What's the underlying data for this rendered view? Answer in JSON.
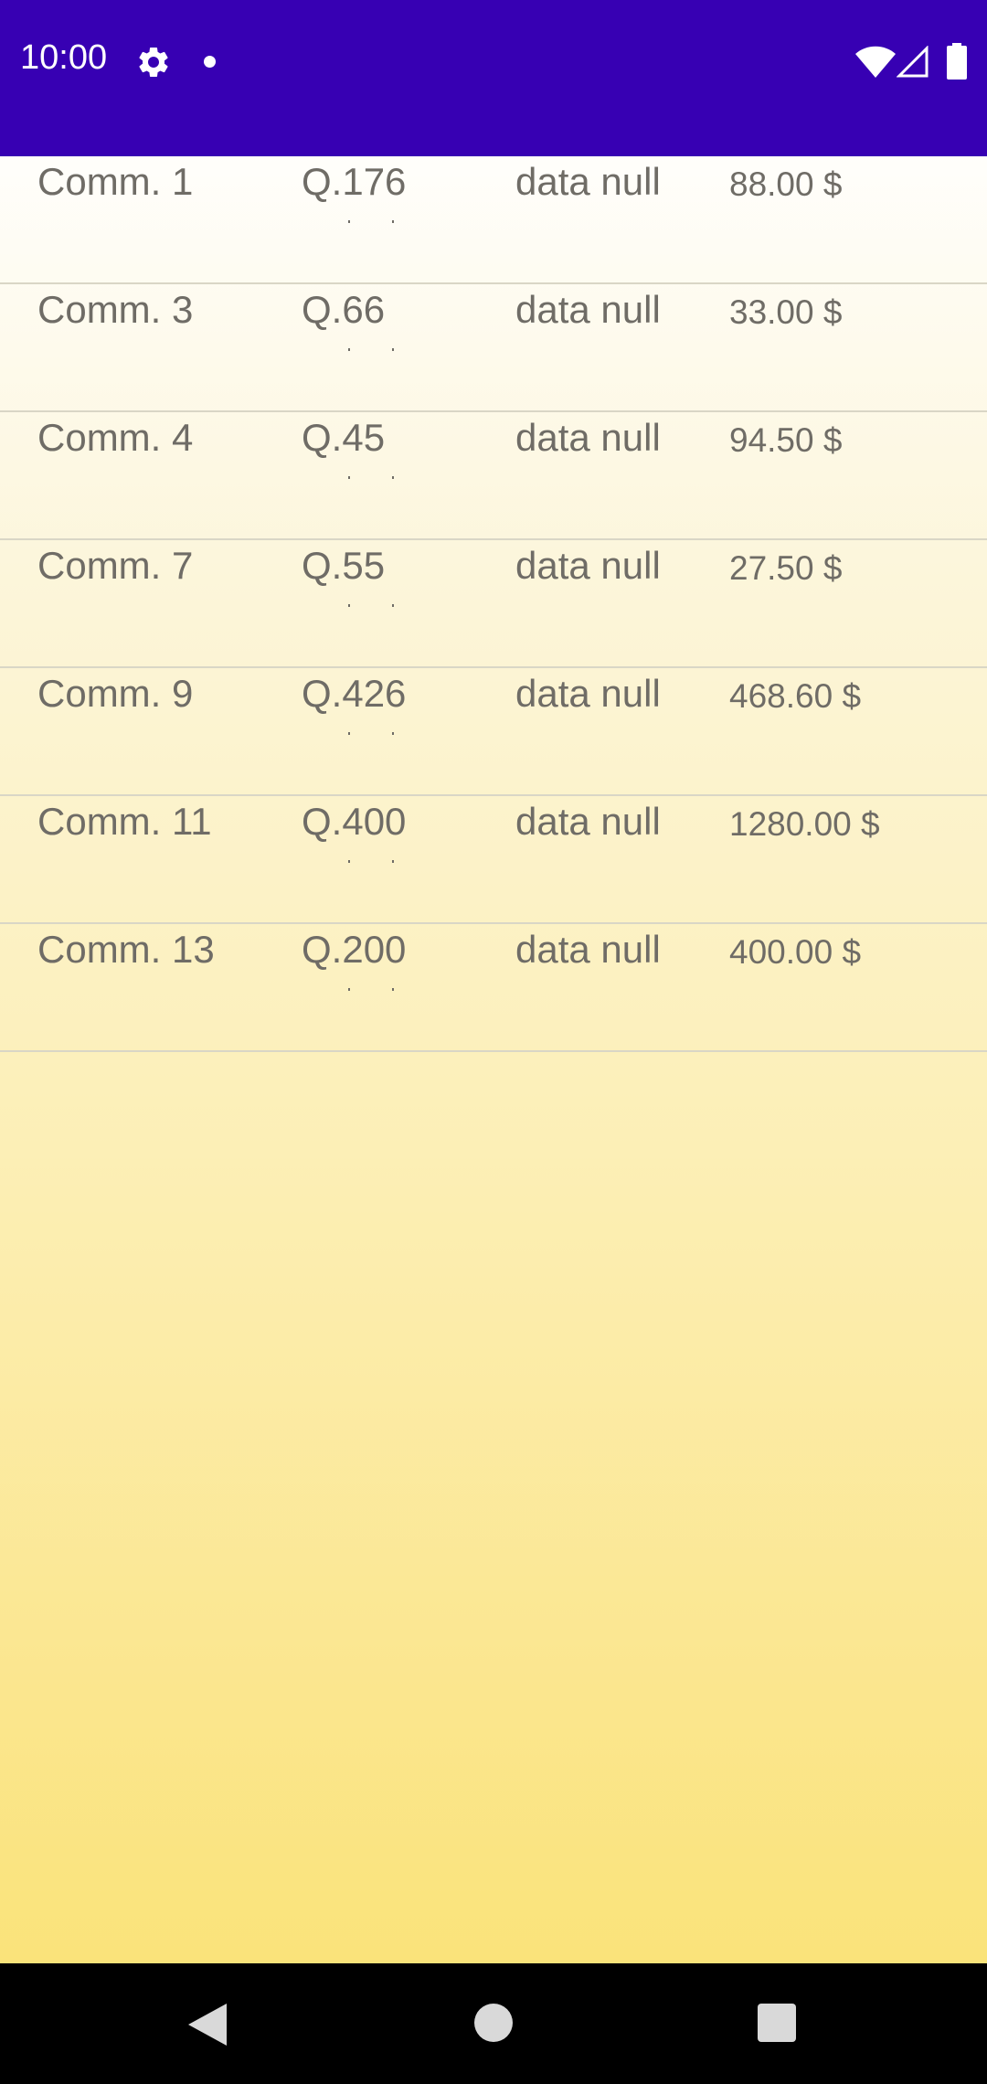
{
  "status_bar": {
    "time": "10:00",
    "background_color": "#3700b3",
    "icons": [
      "gear-icon",
      "notification-dot-icon",
      "wifi-icon",
      "cell-signal-icon",
      "battery-icon"
    ]
  },
  "orders": [
    {
      "name": "Comm. 1",
      "qty": "Q.176",
      "date": "data null",
      "price": "88.00 $"
    },
    {
      "name": "Comm. 3",
      "qty": "Q.66",
      "date": "data null",
      "price": "33.00 $"
    },
    {
      "name": "Comm. 4",
      "qty": "Q.45",
      "date": "data null",
      "price": "94.50 $"
    },
    {
      "name": "Comm. 7",
      "qty": "Q.55",
      "date": "data null",
      "price": "27.50 $"
    },
    {
      "name": "Comm. 9",
      "qty": "Q.426",
      "date": "data null",
      "price": "468.60 $"
    },
    {
      "name": "Comm. 11",
      "qty": "Q.400",
      "date": "data null",
      "price": "1280.00 $"
    },
    {
      "name": "Comm. 13",
      "qty": "Q.200",
      "date": "data null",
      "price": "400.00 $"
    }
  ],
  "nav_bar": {
    "icons": [
      "back-icon",
      "home-icon",
      "recents-icon"
    ]
  }
}
